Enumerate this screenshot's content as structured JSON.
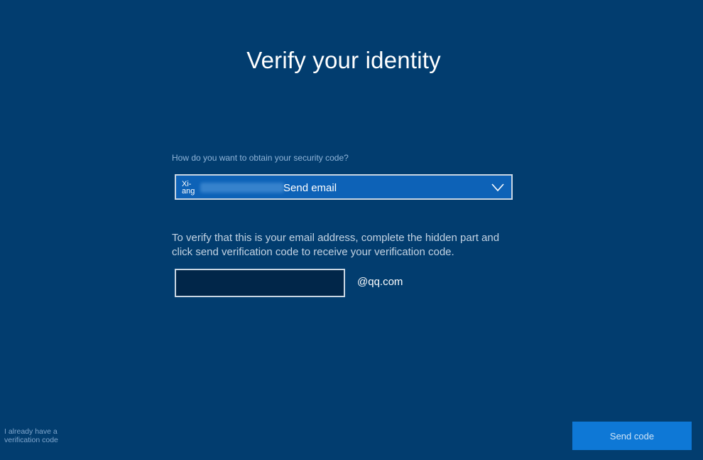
{
  "page": {
    "title": "Verify your identity"
  },
  "verification_method": {
    "question": "How do you want to obtain your security code?",
    "account_name": "Xi-ang",
    "selected_option": "Send email"
  },
  "email_verification": {
    "instruction": "To verify that this is your email address, complete the hidden part and click send verification code to receive your verification code.",
    "input_value": "",
    "input_placeholder": "",
    "domain_suffix": "@qq.com"
  },
  "footer": {
    "have_code_link": "I already have a verification code",
    "send_button": "Send code"
  },
  "icons": {
    "dropdown": "chevron-down-icon"
  },
  "colors": {
    "background": "#023d6f",
    "select_background": "#0d62b7",
    "input_background": "#012649",
    "button_background": "#0e78d6"
  }
}
